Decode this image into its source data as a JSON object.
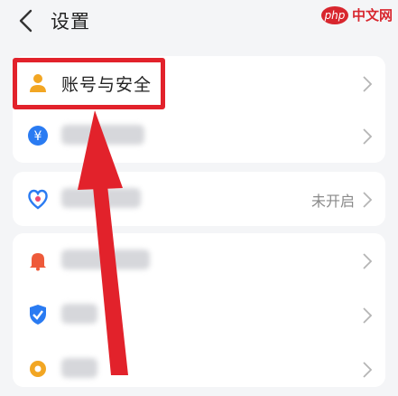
{
  "header": {
    "title": "设置",
    "watermark_logo": "php",
    "watermark_text": "中文网"
  },
  "rows": [
    {
      "label": "账号与安全",
      "icon": "user-icon"
    },
    {
      "label": "",
      "icon": "currency-icon"
    },
    {
      "label": "",
      "icon": "heart-shield-icon",
      "status": "未开启"
    },
    {
      "label": "",
      "icon": "bell-icon"
    },
    {
      "label": "",
      "icon": "shield-check-icon"
    },
    {
      "label": "",
      "icon": "gear-icon"
    }
  ],
  "colors": {
    "highlight": "#e2222b",
    "user_icon": "#f2a623",
    "blue_icon": "#2a7bf2",
    "bell_icon": "#ee5a3a",
    "gear_icon": "#f2a623"
  }
}
